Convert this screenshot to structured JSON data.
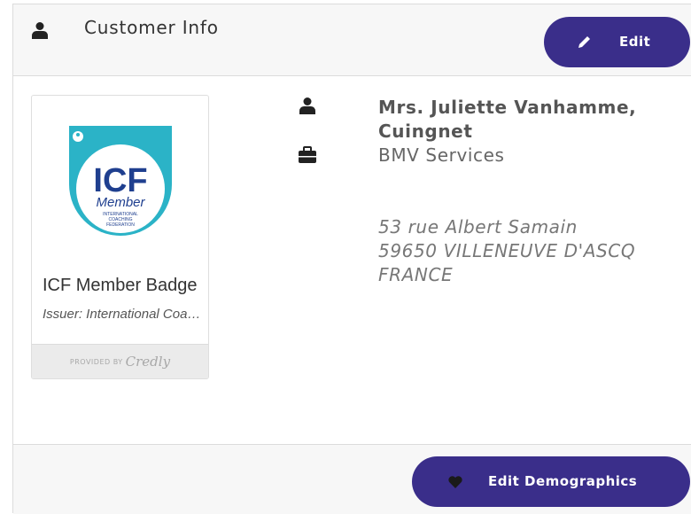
{
  "header": {
    "title": "Customer Info",
    "icon": "user-icon",
    "edit_label": "Edit",
    "edit_icon": "pencil-icon"
  },
  "badge": {
    "logo_text": "ICF",
    "logo_sub": "Member",
    "logo_line1": "INTERNATIONAL",
    "logo_line2": "COACHING",
    "logo_line3": "FEDERATION",
    "name": "ICF Member Badge",
    "issuer": "Issuer: International Coaching Federation",
    "provided_by": "PROVIDED BY",
    "provider": "Credly"
  },
  "customer": {
    "name": "Mrs. Juliette Vanhamme, Cuingnet",
    "company": "BMV Services",
    "address": [
      "53 rue Albert Samain",
      "59650 VILLENEUVE D'ASCQ",
      "FRANCE"
    ]
  },
  "footer": {
    "demographics_label": "Edit Demographics",
    "demographics_icon": "heart-icon"
  },
  "colors": {
    "accent": "#3a2e8a",
    "badge_teal": "#2bb3c7",
    "badge_navy": "#1f3f8f"
  }
}
